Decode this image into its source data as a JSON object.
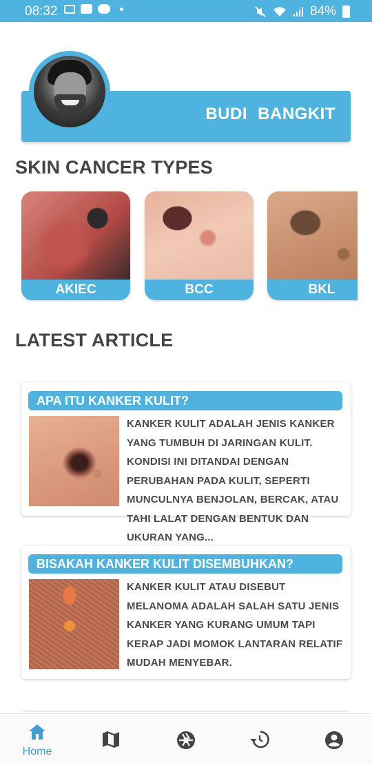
{
  "status_bar": {
    "time": "08:32",
    "battery": "84%"
  },
  "profile": {
    "name": "BUDI BANGKIT"
  },
  "skin_cancer_section": {
    "title": "SKIN CANCER TYPES",
    "types": [
      {
        "label": "AKIEC"
      },
      {
        "label": "BCC"
      },
      {
        "label": "BKL"
      }
    ]
  },
  "latest_article_section": {
    "title": "LATEST ARTICLE",
    "articles": [
      {
        "title": "APA ITU KANKER KULIT?",
        "excerpt": "KANKER KULIT ADALAH JENIS KANKER YANG TUMBUH DI JARINGAN KULIT. KONDISI INI DITANDAI DENGAN PERUBAHAN PADA KULIT, SEPERTI MUNCULNYA BENJOLAN, BERCAK, ATAU TAHI LALAT DENGAN BENTUK DAN UKURAN YANG..."
      },
      {
        "title": "BISAKAH KANKER KULIT DISEMBUHKAN?",
        "excerpt": "KANKER KULIT ATAU DISEBUT MELANOMA ADALAH SALAH SATU JENIS KANKER YANG KURANG UMUM TAPI KERAP JADI MOMOK LANTARAN RELATIF MUDAH MENYEBAR.",
        "ellipsis": "..."
      }
    ]
  },
  "bottom_nav": {
    "items": [
      {
        "label": "Home",
        "icon": "home-icon",
        "active": true
      },
      {
        "icon": "map-icon"
      },
      {
        "icon": "camera-shutter-icon"
      },
      {
        "icon": "history-icon"
      },
      {
        "icon": "account-icon"
      }
    ],
    "active_color": "#3f9fd0",
    "inactive_color": "#444444"
  },
  "colors": {
    "accent": "#4fb3e0"
  }
}
